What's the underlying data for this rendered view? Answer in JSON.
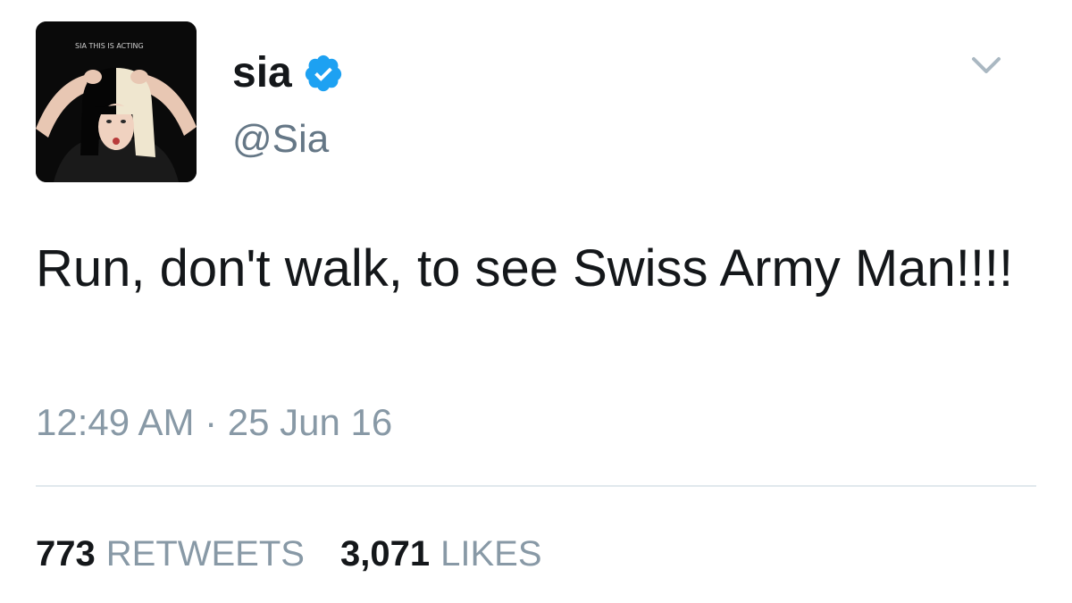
{
  "user": {
    "display_name": "sia",
    "handle": "@Sia",
    "verified": true,
    "avatar_caption": "SIA THIS IS ACTING"
  },
  "tweet": {
    "text": "Run, don't walk, to see Swiss Army Man!!!!",
    "timestamp": "12:49 AM · 25 Jun 16"
  },
  "stats": {
    "retweets_count": "773",
    "retweets_label": "RETWEETS",
    "likes_count": "3,071",
    "likes_label": "LIKES"
  },
  "icons": {
    "verified": "verified-badge-icon",
    "menu": "chevron-down-icon"
  },
  "colors": {
    "verified_blue": "#1da1f2",
    "secondary_text": "#657786",
    "muted_text": "#8899a6",
    "divider": "#e1e8ed"
  }
}
